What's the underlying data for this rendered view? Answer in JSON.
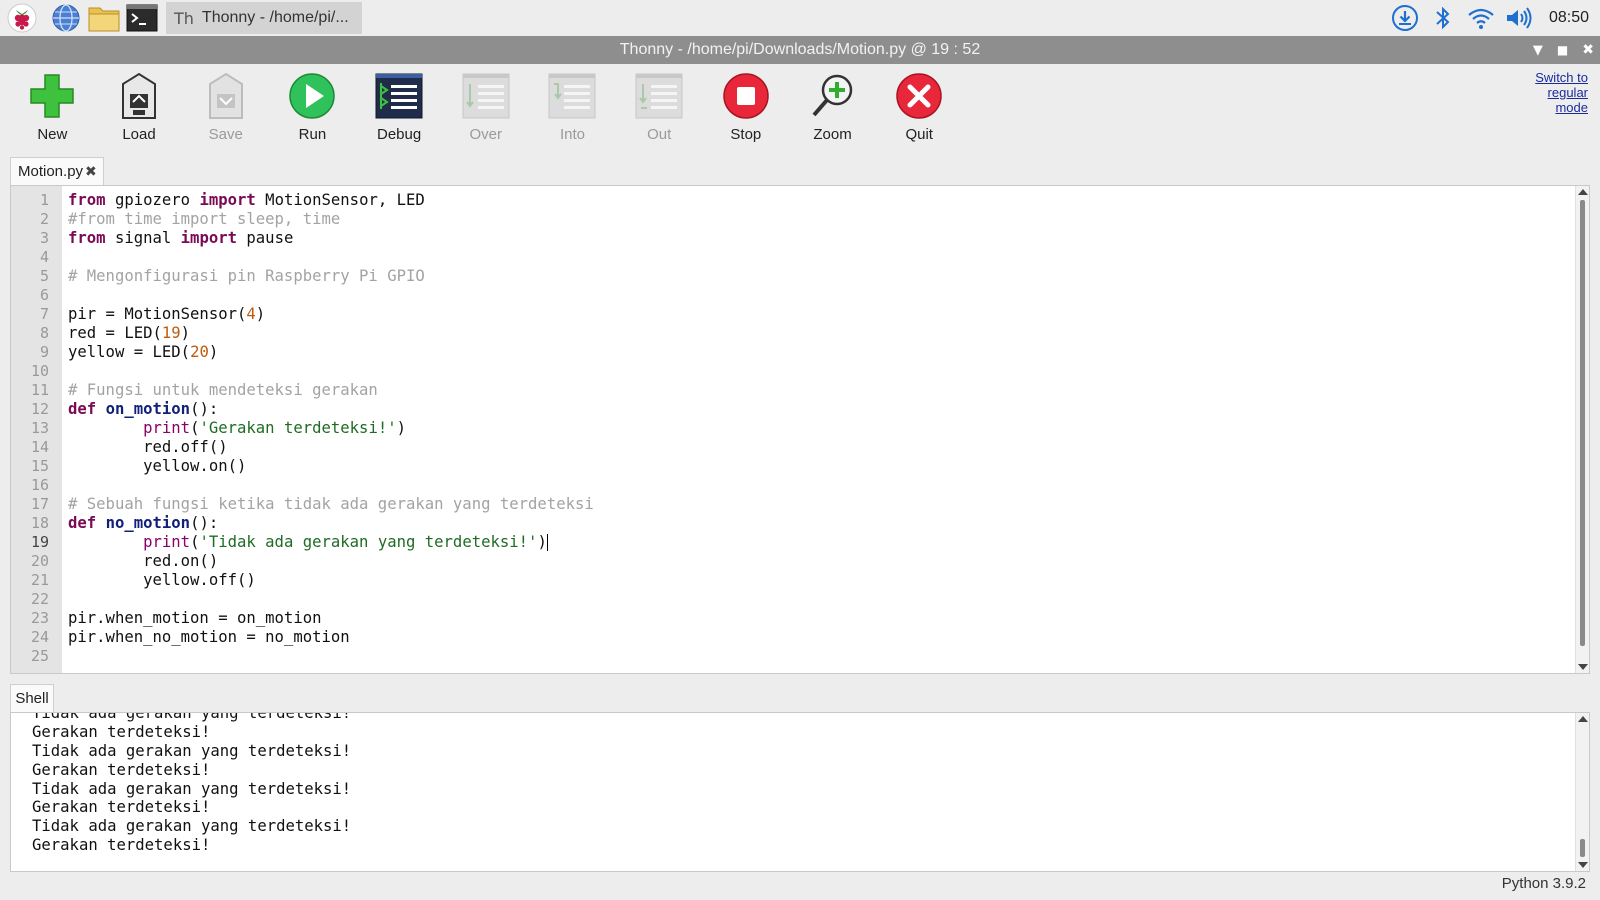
{
  "taskbar": {
    "task_title": "Thonny  -  /home/pi/...",
    "clock": "08:50",
    "launchers": [
      "raspberry-menu-icon",
      "web-browser-icon",
      "file-manager-icon",
      "terminal-icon"
    ],
    "tray": [
      "download-icon",
      "bluetooth-icon",
      "wifi-icon",
      "volume-icon"
    ]
  },
  "window": {
    "title": "Thonny  -  /home/pi/Downloads/Motion.py  @  19 : 52",
    "controls": [
      "minimize-icon",
      "maximize-icon",
      "close-icon"
    ]
  },
  "toolbar": {
    "new": "New",
    "load": "Load",
    "save": "Save",
    "run": "Run",
    "debug": "Debug",
    "over": "Over",
    "into": "Into",
    "out": "Out",
    "stop": "Stop",
    "zoom": "Zoom",
    "quit": "Quit",
    "mode_switch_1": "Switch to",
    "mode_switch_2": "regular",
    "mode_switch_3": "mode"
  },
  "editor": {
    "tab_label": "Motion.py",
    "cursor_line": 19,
    "line_numbers": [
      "1",
      "2",
      "3",
      "4",
      "5",
      "6",
      "7",
      "8",
      "9",
      "10",
      "11",
      "12",
      "13",
      "14",
      "15",
      "16",
      "17",
      "18",
      "19",
      "20",
      "21",
      "22",
      "23",
      "24",
      "25"
    ],
    "lines": [
      [
        {
          "t": "kw",
          "v": "from"
        },
        {
          "t": "",
          "v": " gpiozero "
        },
        {
          "t": "kw",
          "v": "import"
        },
        {
          "t": "",
          "v": " MotionSensor, LED"
        }
      ],
      [
        {
          "t": "cm",
          "v": "#from time import sleep, time"
        }
      ],
      [
        {
          "t": "kw",
          "v": "from"
        },
        {
          "t": "",
          "v": " signal "
        },
        {
          "t": "kw",
          "v": "import"
        },
        {
          "t": "",
          "v": " pause"
        }
      ],
      [],
      [
        {
          "t": "cm",
          "v": "# Mengonfigurasi pin Raspberry Pi GPIO"
        }
      ],
      [],
      [
        {
          "t": "",
          "v": "pir = MotionSensor("
        },
        {
          "t": "num",
          "v": "4"
        },
        {
          "t": "",
          "v": ")"
        }
      ],
      [
        {
          "t": "",
          "v": "red = LED("
        },
        {
          "t": "num",
          "v": "19"
        },
        {
          "t": "",
          "v": ")"
        }
      ],
      [
        {
          "t": "",
          "v": "yellow = LED("
        },
        {
          "t": "num",
          "v": "20"
        },
        {
          "t": "",
          "v": ")"
        }
      ],
      [],
      [
        {
          "t": "cm",
          "v": "# Fungsi untuk mendeteksi gerakan"
        }
      ],
      [
        {
          "t": "kw",
          "v": "def"
        },
        {
          "t": "",
          "v": " "
        },
        {
          "t": "fn",
          "v": "on_motion"
        },
        {
          "t": "",
          "v": "():"
        }
      ],
      [
        {
          "t": "",
          "v": "        "
        },
        {
          "t": "bi",
          "v": "print"
        },
        {
          "t": "",
          "v": "("
        },
        {
          "t": "str",
          "v": "'Gerakan terdeteksi!'"
        },
        {
          "t": "",
          "v": ")"
        }
      ],
      [
        {
          "t": "",
          "v": "        red.off()"
        }
      ],
      [
        {
          "t": "",
          "v": "        yellow.on()"
        }
      ],
      [],
      [
        {
          "t": "cm",
          "v": "# Sebuah fungsi ketika tidak ada gerakan yang terdeteksi"
        }
      ],
      [
        {
          "t": "kw",
          "v": "def"
        },
        {
          "t": "",
          "v": " "
        },
        {
          "t": "fn",
          "v": "no_motion"
        },
        {
          "t": "",
          "v": "():"
        }
      ],
      [
        {
          "t": "",
          "v": "        "
        },
        {
          "t": "bi",
          "v": "print"
        },
        {
          "t": "",
          "v": "("
        },
        {
          "t": "str",
          "v": "'Tidak ada gerakan yang terdeteksi!'"
        },
        {
          "t": "",
          "v": ")"
        },
        {
          "t": "caret",
          "v": ""
        }
      ],
      [
        {
          "t": "",
          "v": "        red.on()"
        }
      ],
      [
        {
          "t": "",
          "v": "        yellow.off()"
        }
      ],
      [],
      [
        {
          "t": "",
          "v": "pir.when_motion = on_motion"
        }
      ],
      [
        {
          "t": "",
          "v": "pir.when_no_motion = no_motion"
        }
      ],
      []
    ]
  },
  "shell": {
    "tab_label": "Shell",
    "lines": [
      "Tidak ada gerakan yang terdeteksi!",
      "Gerakan terdeteksi!",
      "Tidak ada gerakan yang terdeteksi!",
      "Gerakan terdeteksi!",
      "Tidak ada gerakan yang terdeteksi!",
      "Gerakan terdeteksi!",
      "Tidak ada gerakan yang terdeteksi!",
      "Gerakan terdeteksi!"
    ]
  },
  "status": {
    "interpreter": "Python 3.9.2"
  }
}
